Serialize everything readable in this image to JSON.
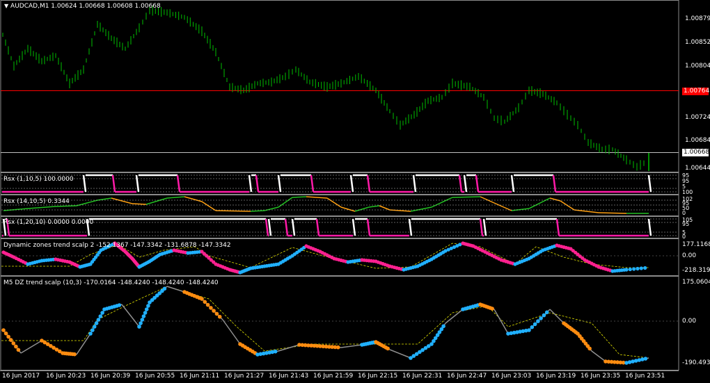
{
  "main": {
    "symbol_title": "AUDCAD,M1  1.00624 1.00668 1.00608 1.00668",
    "price_ticks": [
      "1.00879",
      "1.00852",
      "1.00804",
      "1.00724",
      "1.00684",
      "1.00644"
    ],
    "red_line_label": "1.00764",
    "current_label": "1.00668",
    "colors": {
      "bars": "#00c000",
      "red_line": "#ff0000",
      "current_line": "#c0c0c0",
      "bg": "#000000",
      "grid_text": "#ffffff"
    }
  },
  "panes": [
    {
      "title": "Rsx (1,10,5) 100.0000",
      "scale": [
        "95",
        "95",
        "5",
        "5",
        "100"
      ]
    },
    {
      "title": "Rsx (14,10,5) 0.3344",
      "scale": [
        "102",
        "95",
        "50",
        "5",
        "0"
      ]
    },
    {
      "title": "Rsx (1,20,10) 0.0000 0.0000",
      "scale": [
        "105",
        "95",
        "5",
        "5",
        "0"
      ]
    },
    {
      "title": "Dynamic zones trend scalp 2 -152.1367 -147.3342 -131.6878 -147.3342",
      "scale": [
        "177.1168",
        "0.00",
        "-218.3191"
      ]
    },
    {
      "title": "M5 DZ trend scalp (10,3) -170.0164 -148.4240 -148.4240 -148.4240",
      "scale": [
        "175.0604",
        "0.00",
        "-190.4937"
      ]
    }
  ],
  "time_axis": [
    "16 Jun 2017",
    "16 Jun 20:23",
    "16 Jun 20:39",
    "16 Jun 20:55",
    "16 Jun 21:11",
    "16 Jun 21:27",
    "16 Jun 21:43",
    "16 Jun 21:59",
    "16 Jun 22:15",
    "16 Jun 22:31",
    "16 Jun 22:47",
    "16 Jun 23:03",
    "16 Jun 23:19",
    "16 Jun 23:35",
    "16 Jun 23:51"
  ],
  "colors": {
    "white_step": "#ffffff",
    "magenta_step": "#ff1aa8",
    "green_line": "#22c022",
    "orange_line": "#ffa010",
    "cyan_dot": "#20b0ff",
    "pink_dot": "#ff2090",
    "orange_dot": "#ff8c10",
    "gray_line": "#909090",
    "yellow_dash": "#e6e600"
  }
}
